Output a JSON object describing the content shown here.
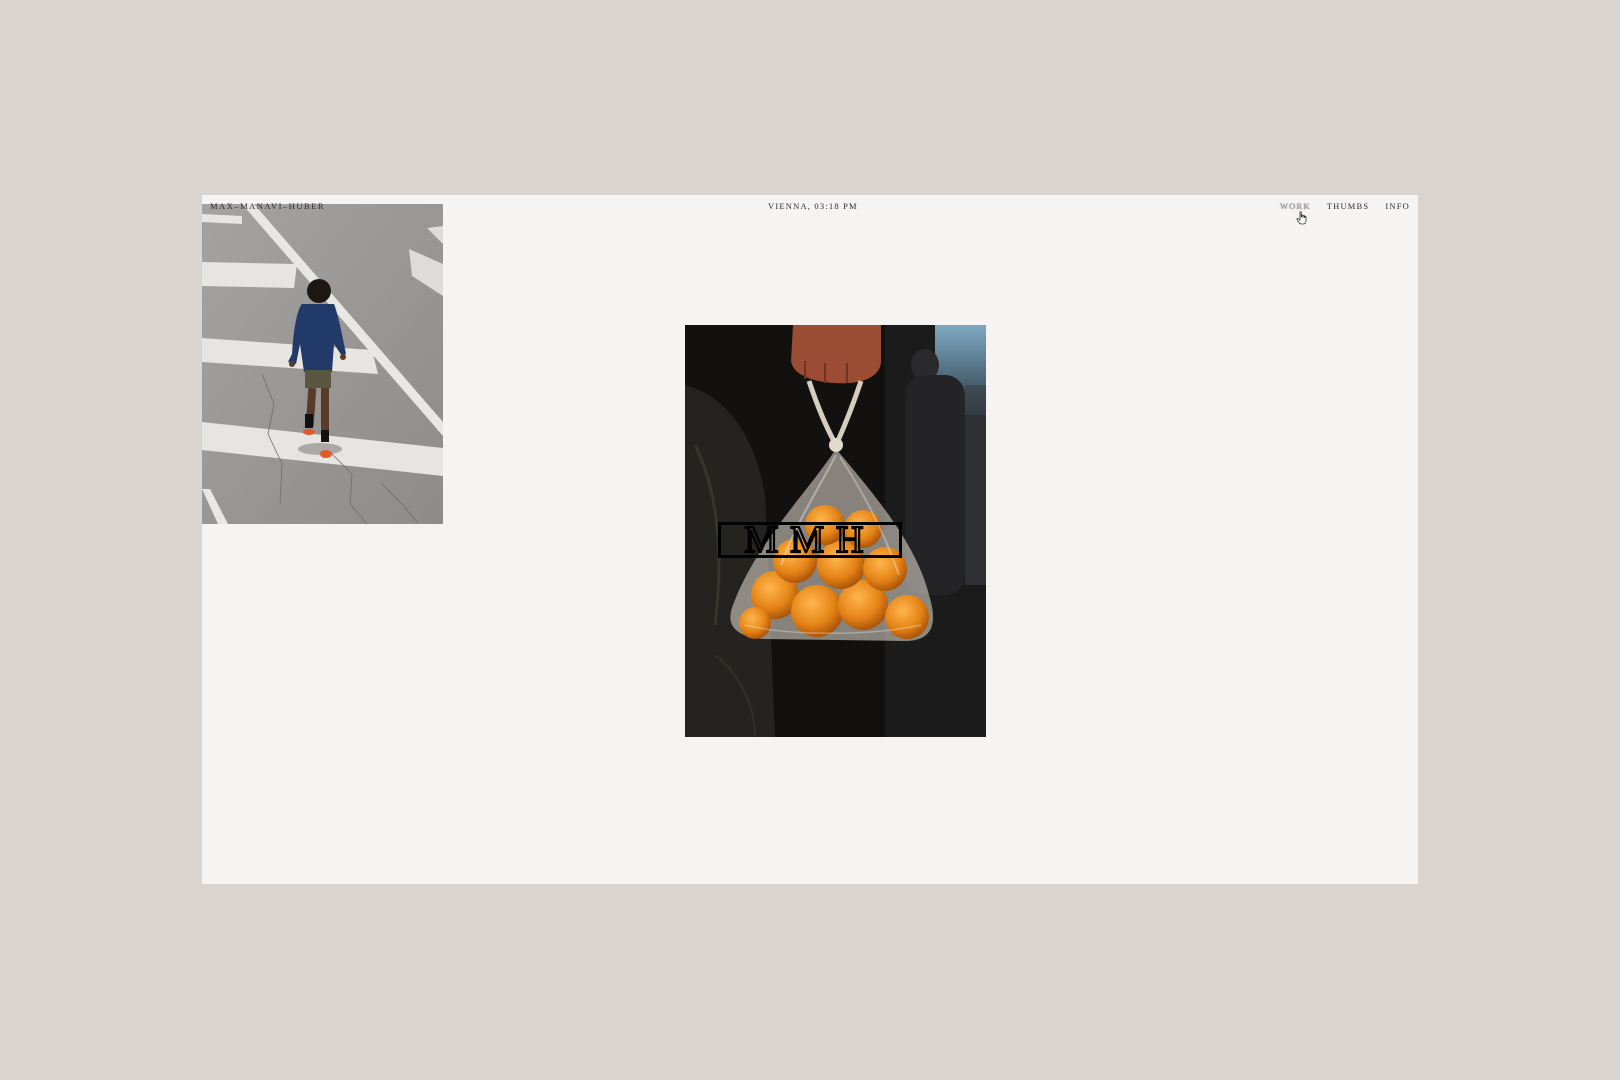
{
  "site": {
    "brand": "MAX–MANAVI–HUBER",
    "clock": "VIENNA, 03:18 PM"
  },
  "nav": {
    "items": [
      {
        "label": "WORK",
        "active": true
      },
      {
        "label": "THUMBS",
        "active": false
      },
      {
        "label": "INFO",
        "active": false
      }
    ]
  },
  "overlay": {
    "logo_text": "MMH"
  },
  "images": {
    "runner": "photo-person-crossing-street",
    "oranges": "photo-hand-holding-bag-of-oranges"
  },
  "colors": {
    "page_background": "#d9d4cf",
    "canvas_background": "#f5f4f2",
    "text": "#2a2a2a",
    "active_nav": "#8f8f8f"
  }
}
